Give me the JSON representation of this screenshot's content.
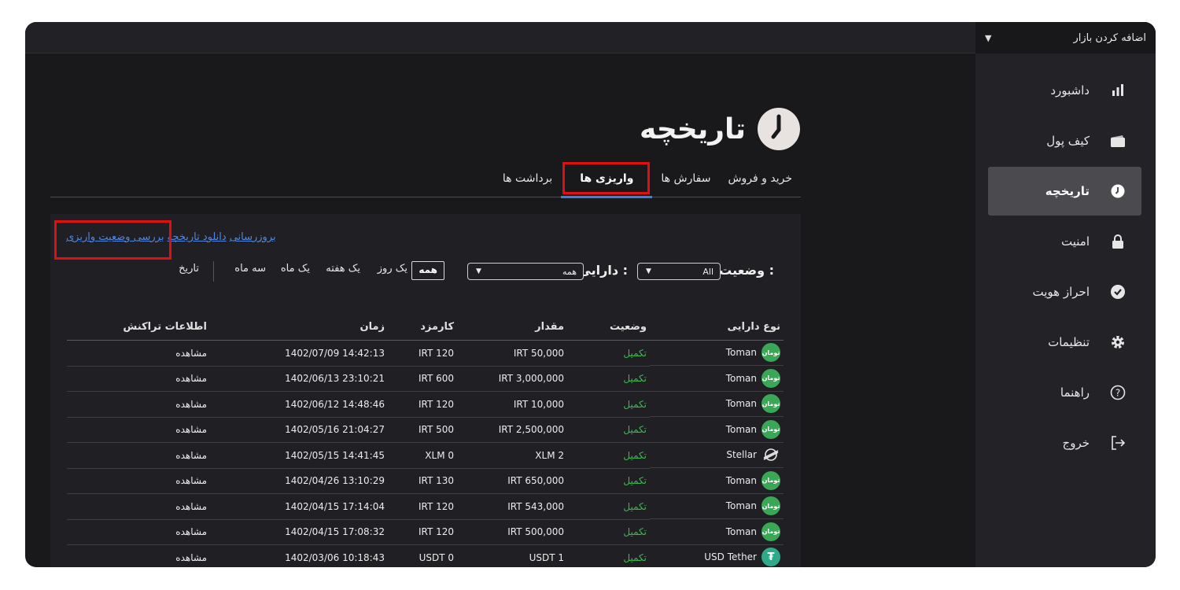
{
  "sidebar": {
    "market_add": "اضافه کردن بازار",
    "items": [
      {
        "label": "داشبورد",
        "icon": "bar-chart-icon"
      },
      {
        "label": "کیف پول",
        "icon": "wallet-icon"
      },
      {
        "label": "تاریخچه",
        "icon": "clock-icon",
        "active": true
      },
      {
        "label": "امنیت",
        "icon": "lock-icon"
      },
      {
        "label": "احراز هویت",
        "icon": "verified-badge-icon"
      },
      {
        "label": "تنظیمات",
        "icon": "gear-icon"
      },
      {
        "label": "راهنما",
        "icon": "help-circle-icon"
      },
      {
        "label": "خروج",
        "icon": "logout-icon"
      }
    ]
  },
  "page": {
    "title": "تاریخچه"
  },
  "tabs": [
    {
      "label": "خرید و فروش"
    },
    {
      "label": "سفارش ها"
    },
    {
      "label": "واریزی ها",
      "active": true
    },
    {
      "label": "برداشت ها"
    }
  ],
  "links": {
    "refresh": "بروزرسانی",
    "download": "دانلود تاریخچه",
    "check_status": "بررسی وضعیت واریزی"
  },
  "filters": {
    "status_label": "وضعیت :",
    "status_value": "All",
    "asset_label": "دارایی :",
    "asset_value": "همه",
    "ranges": [
      "همه",
      "یک روز",
      "یک هفته",
      "یک ماه",
      "سه ماه"
    ],
    "date_label": "تاریخ"
  },
  "table": {
    "headers": [
      "نوع دارایی",
      "وضعیت",
      "مقدار",
      "کارمزد",
      "زمان",
      "اطلاعات تراکنش"
    ],
    "rows": [
      {
        "asset": "Toman",
        "coin": "toman",
        "status": "تکمیل",
        "amount": "IRT 50,000",
        "fee": "IRT 120",
        "time": "14:42:13 1402/07/09",
        "info": "مشاهده"
      },
      {
        "asset": "Toman",
        "coin": "toman",
        "status": "تکمیل",
        "amount": "IRT 3,000,000",
        "fee": "IRT 600",
        "time": "23:10:21 1402/06/13",
        "info": "مشاهده"
      },
      {
        "asset": "Toman",
        "coin": "toman",
        "status": "تکمیل",
        "amount": "IRT 10,000",
        "fee": "IRT 120",
        "time": "14:48:46 1402/06/12",
        "info": "مشاهده"
      },
      {
        "asset": "Toman",
        "coin": "toman",
        "status": "تکمیل",
        "amount": "IRT 2,500,000",
        "fee": "IRT 500",
        "time": "21:04:27 1402/05/16",
        "info": "مشاهده"
      },
      {
        "asset": "Stellar",
        "coin": "stellar",
        "status": "تکمیل",
        "amount": "XLM 2",
        "fee": "XLM 0",
        "time": "14:41:45 1402/05/15",
        "info": "مشاهده"
      },
      {
        "asset": "Toman",
        "coin": "toman",
        "status": "تکمیل",
        "amount": "IRT 650,000",
        "fee": "IRT 130",
        "time": "13:10:29 1402/04/26",
        "info": "مشاهده"
      },
      {
        "asset": "Toman",
        "coin": "toman",
        "status": "تکمیل",
        "amount": "IRT 543,000",
        "fee": "IRT 120",
        "time": "17:14:04 1402/04/15",
        "info": "مشاهده"
      },
      {
        "asset": "Toman",
        "coin": "toman",
        "status": "تکمیل",
        "amount": "IRT 500,000",
        "fee": "IRT 120",
        "time": "17:08:32 1402/04/15",
        "info": "مشاهده"
      },
      {
        "asset": "USD Tether",
        "coin": "tether",
        "status": "تکمیل",
        "amount": "USDT 1",
        "fee": "USDT 0",
        "time": "10:18:43 1402/03/06",
        "info": "مشاهده"
      }
    ],
    "toman_coin_text": "تومان",
    "tether_coin_text": "₮"
  },
  "colors": {
    "accent": "#4a7bd8",
    "highlight": "#e01010",
    "success": "#3dba4e"
  }
}
